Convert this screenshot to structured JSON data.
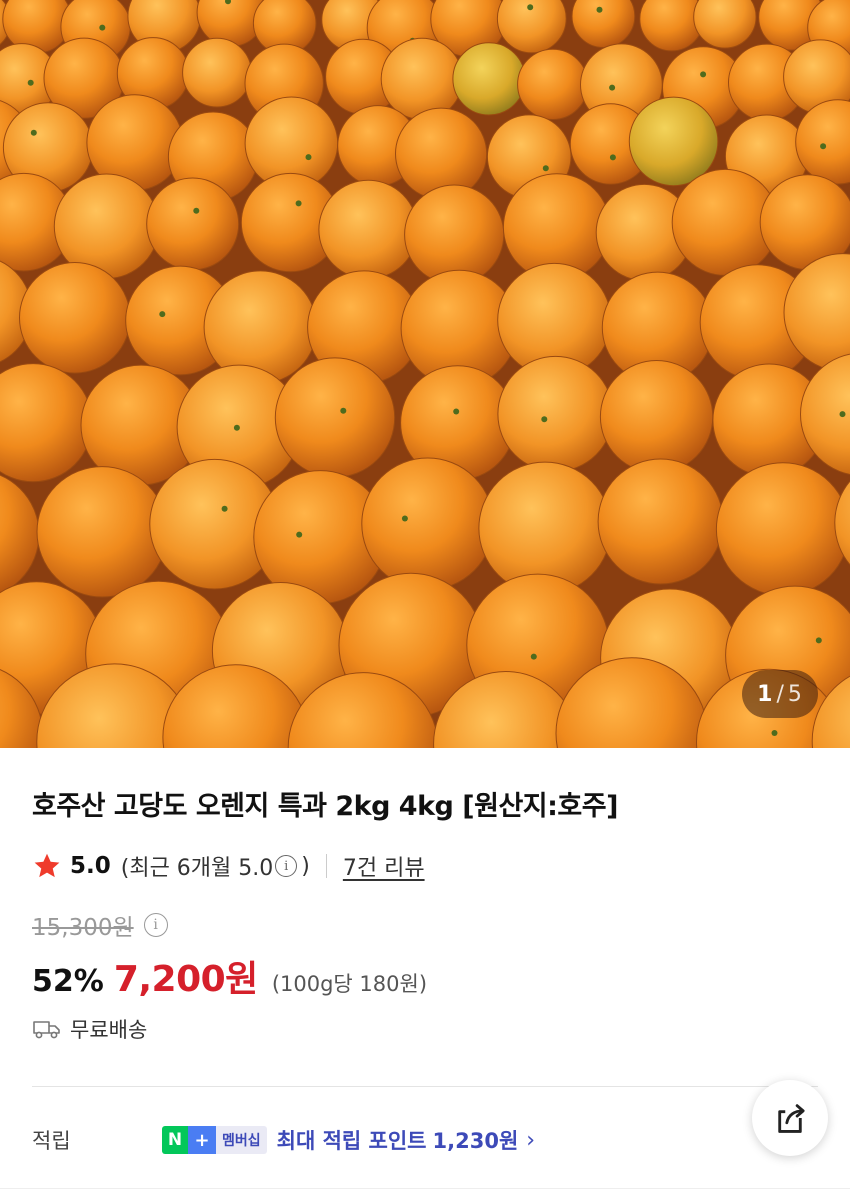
{
  "image": {
    "alt": "orange",
    "counter": {
      "current": "1",
      "separator": "/",
      "total": "5"
    }
  },
  "product": {
    "title": "호주산 고당도 오렌지 특과 2kg 4kg [원산지:호주]",
    "rating": {
      "score": "5.0",
      "recent_open": "(최근 6개월 5.0",
      "recent_close": ")",
      "reviews": "7건 리뷰"
    },
    "original_price": "15,300원",
    "discount": "52%",
    "price": "7,200원",
    "unit_price": "(100g당 180원)",
    "shipping": "무료배송"
  },
  "points": {
    "label": "적립",
    "badge": {
      "n": "N",
      "plus": "+",
      "membership": "멤버십"
    },
    "text": "최대 적립 포인트",
    "amount": "1,230원",
    "chevron": "›"
  },
  "icons": {
    "star": "star-icon",
    "info": "info-icon",
    "truck": "truck-icon",
    "share": "share-icon",
    "chevron": "chevron-right-icon"
  },
  "colors": {
    "price_red": "#d5202b",
    "star_red": "#ef3b2c",
    "points_blue": "#3d4ab8",
    "naver_green": "#03c75a"
  }
}
